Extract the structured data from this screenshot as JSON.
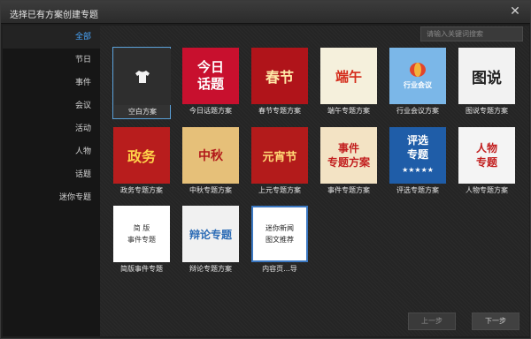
{
  "title": "选择已有方案创建专题",
  "sidebar": {
    "items": [
      {
        "label": "全部",
        "active": true
      },
      {
        "label": "节日"
      },
      {
        "label": "事件"
      },
      {
        "label": "会议"
      },
      {
        "label": "活动"
      },
      {
        "label": "人物"
      },
      {
        "label": "话题"
      },
      {
        "label": "迷你专题"
      }
    ]
  },
  "search": {
    "placeholder": "请输入关键词搜索"
  },
  "templates": [
    {
      "label": "空白方案",
      "art": "",
      "selected": true
    },
    {
      "label": "今日话题方案",
      "art": "今日\n话题"
    },
    {
      "label": "春节专题方案",
      "art": "春节"
    },
    {
      "label": "端午专题方案",
      "art": "端午"
    },
    {
      "label": "行业会议方案",
      "art": "行业会议"
    },
    {
      "label": "图说专题方案",
      "art": "图说"
    },
    {
      "label": "政务专题方案",
      "art": "政务"
    },
    {
      "label": "中秋专题方案",
      "art": "中秋"
    },
    {
      "label": "上元专题方案",
      "art": "元宵节"
    },
    {
      "label": "事件专题方案",
      "art": "事件\n专题方案"
    },
    {
      "label": "评选专题方案",
      "art": "评选\n专题"
    },
    {
      "label": "人物专题方案",
      "art": "人物\n专题"
    },
    {
      "label": "简版事件专题",
      "art": "简 版\n事件专题"
    },
    {
      "label": "辩论专题方案",
      "art": "辩论专题"
    },
    {
      "label": "内容页...导",
      "art": "迷你新闻\n图文推荐"
    }
  ],
  "buttons": {
    "prev": "上一步",
    "next": "下一步"
  },
  "icons": {
    "close": "close-icon",
    "blank": "shirt-icon"
  },
  "colors": {
    "accent": "#4aa8ff",
    "background": "#1f1f1f"
  }
}
